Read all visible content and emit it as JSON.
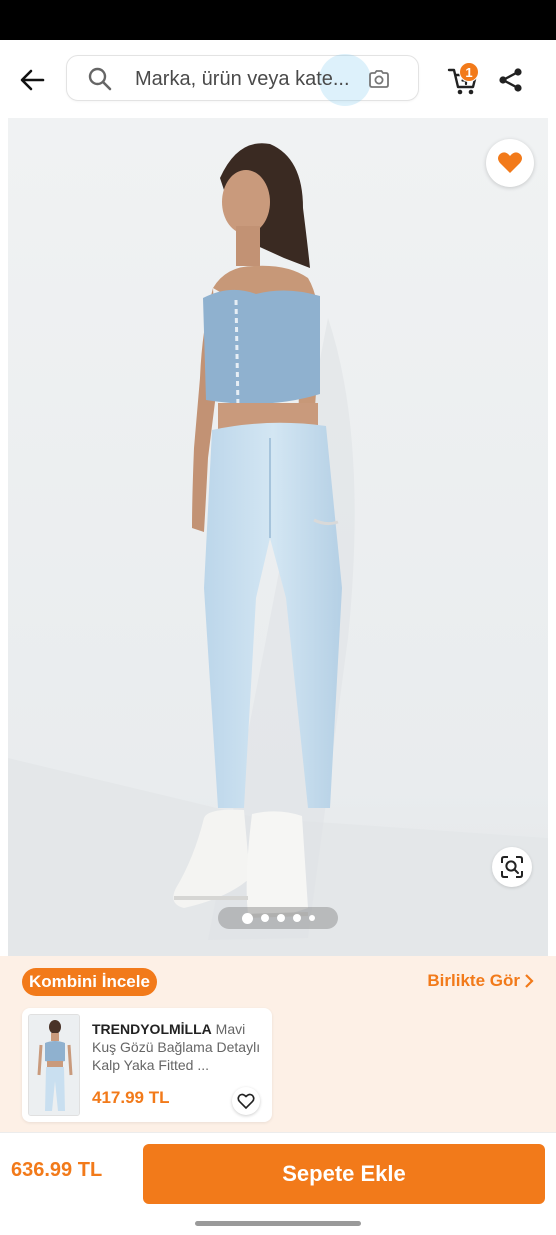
{
  "search": {
    "placeholder": "Marka, ürün veya kate...",
    "icon": "search-icon",
    "camera_icon": "camera-search-icon"
  },
  "header": {
    "back_icon": "arrow-left-icon",
    "cart_icon": "cart-icon",
    "cart_count": "1",
    "share_icon": "share-icon"
  },
  "gallery": {
    "favorite_icon": "heart-filled-icon",
    "zoom_icon": "visual-search-icon",
    "page_dots": 5,
    "active_page": 1
  },
  "combine": {
    "pill_label": "Kombini İncele",
    "see_together_label": "Birlikte Gör",
    "card": {
      "brand": "TRENDYOLMİLLA",
      "title": "Mavi Kuş Gözü Bağlama Detaylı Kalp Yaka Fitted ...",
      "price": "417.99 TL"
    }
  },
  "footer": {
    "price": "636.99 TL",
    "add_to_cart_label": "Sepete Ekle"
  },
  "colors": {
    "accent": "#f27a1a",
    "combine_bg": "#fdf0e6"
  }
}
